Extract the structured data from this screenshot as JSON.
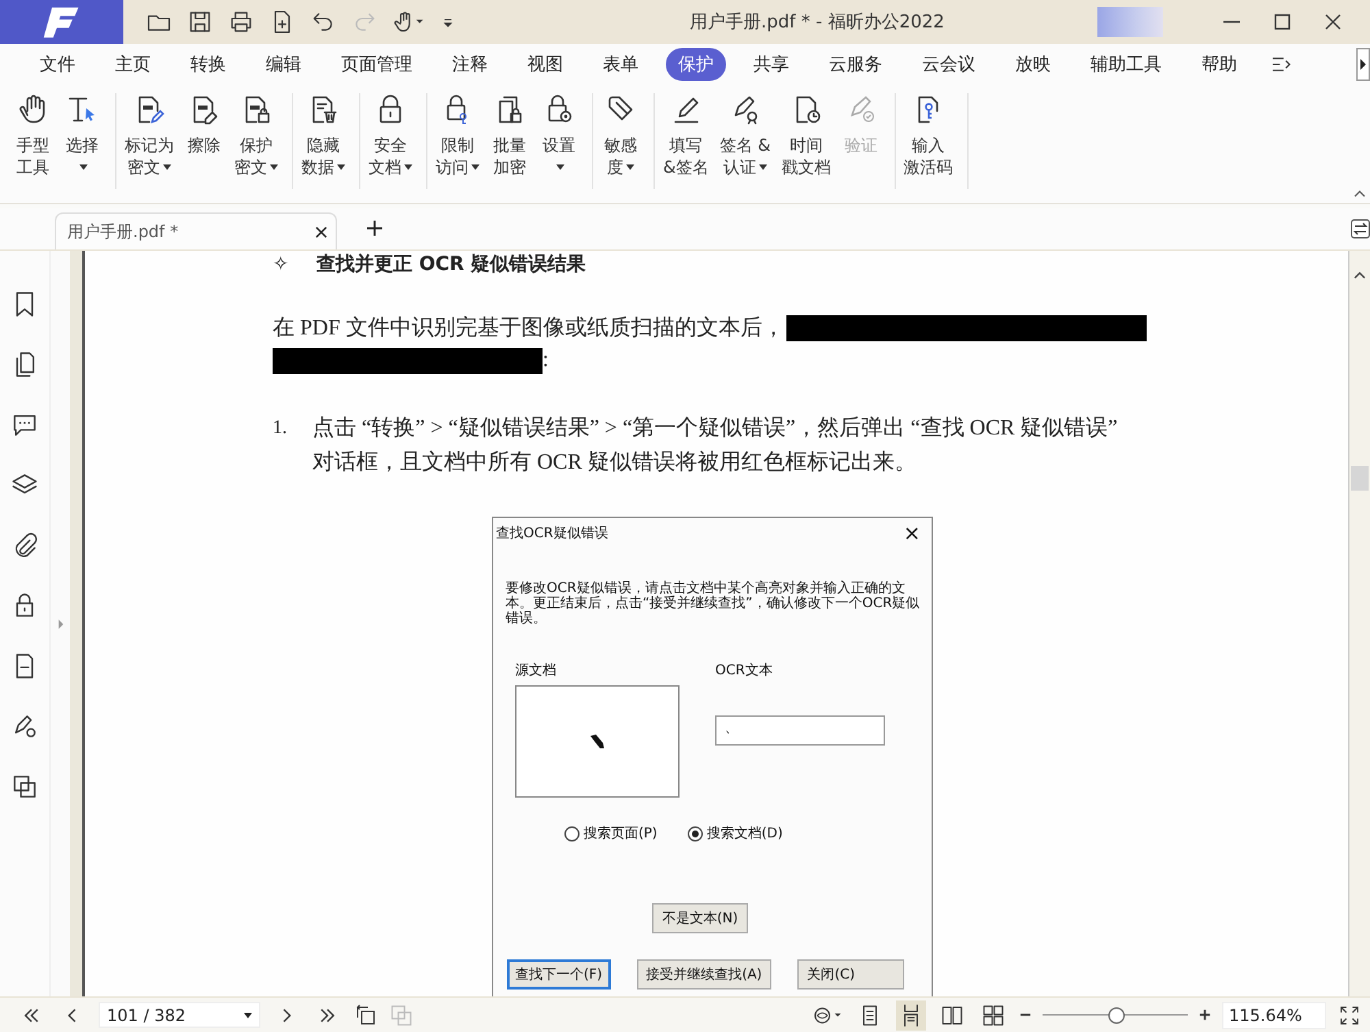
{
  "window": {
    "title": "用户手册.pdf * - 福昕办公2022"
  },
  "menu": [
    {
      "label": "文件",
      "selected": false
    },
    {
      "label": "主页",
      "selected": false
    },
    {
      "label": "转换",
      "selected": false
    },
    {
      "label": "编辑",
      "selected": false
    },
    {
      "label": "页面管理",
      "selected": false
    },
    {
      "label": "注释",
      "selected": false
    },
    {
      "label": "视图",
      "selected": false
    },
    {
      "label": "表单",
      "selected": false
    },
    {
      "label": "保护",
      "selected": true
    },
    {
      "label": "共享",
      "selected": false
    },
    {
      "label": "云服务",
      "selected": false
    },
    {
      "label": "云会议",
      "selected": false
    },
    {
      "label": "放映",
      "selected": false
    },
    {
      "label": "辅助工具",
      "selected": false
    },
    {
      "label": "帮助",
      "selected": false
    }
  ],
  "ribbon": [
    {
      "items": [
        {
          "lines": [
            "手型",
            "工具"
          ],
          "dropdown": false,
          "disabled": false
        },
        {
          "lines": [
            "选择"
          ],
          "dropdown": true,
          "disabled": false
        }
      ]
    },
    {
      "items": [
        {
          "lines": [
            "标记为",
            "密文"
          ],
          "dropdown": true,
          "disabled": false
        },
        {
          "lines": [
            "擦除"
          ],
          "dropdown": false,
          "disabled": false
        },
        {
          "lines": [
            "保护",
            "密文"
          ],
          "dropdown": true,
          "disabled": false
        }
      ]
    },
    {
      "items": [
        {
          "lines": [
            "隐藏",
            "数据"
          ],
          "dropdown": true,
          "disabled": false
        }
      ]
    },
    {
      "items": [
        {
          "lines": [
            "安全",
            "文档"
          ],
          "dropdown": true,
          "disabled": false
        }
      ]
    },
    {
      "items": [
        {
          "lines": [
            "限制",
            "访问"
          ],
          "dropdown": true,
          "disabled": false
        },
        {
          "lines": [
            "批量",
            "加密"
          ],
          "dropdown": false,
          "disabled": false
        },
        {
          "lines": [
            "设置"
          ],
          "dropdown": true,
          "disabled": false
        }
      ]
    },
    {
      "items": [
        {
          "lines": [
            "敏感",
            "度"
          ],
          "dropdown": true,
          "disabled": false
        }
      ]
    },
    {
      "items": [
        {
          "lines": [
            "填写",
            "&签名"
          ],
          "dropdown": false,
          "disabled": false
        },
        {
          "lines": [
            "签名 &",
            "认证"
          ],
          "dropdown": true,
          "disabled": false
        },
        {
          "lines": [
            "时间",
            "戳文档"
          ],
          "dropdown": false,
          "disabled": false
        },
        {
          "lines": [
            "验证"
          ],
          "dropdown": false,
          "disabled": true
        }
      ]
    },
    {
      "items": [
        {
          "lines": [
            "输入",
            "激活码"
          ],
          "dropdown": false,
          "disabled": false
        }
      ]
    }
  ],
  "doc_tabs": [
    {
      "label": "用户手册.pdf *"
    }
  ],
  "document": {
    "heading_mark": "✧",
    "heading": "查找并更正 OCR 疑似错误结果",
    "paragraph": "在 PDF 文件中识别完基于图像或纸质扫描的文本后，",
    "paragraph_end": ":",
    "list": [
      {
        "number": "1.",
        "lines": [
          "点击 “转换” > “疑似错误结果” > “第一个疑似错误”，然后弹出 “查找 OCR 疑似错误”",
          "对话框，且文档中所有 OCR 疑似错误将被用红色框标记出来。"
        ]
      }
    ]
  },
  "dialog": {
    "title": "查找OCR疑似错误",
    "close": "×",
    "description": "要修改OCR疑似错误，请点击文档中某个高亮对象并输入正确的文本。更正结束后，点击“接受并继续查找”，确认修改下一个OCR疑似错误。",
    "source_label": "源文档",
    "ocr_label": "OCR文本",
    "ocr_value": "、",
    "radios": [
      {
        "label": "搜索页面(P)",
        "selected": false
      },
      {
        "label": "搜索文档(D)",
        "selected": true
      }
    ],
    "middle_button": "不是文本(N)",
    "buttons": [
      {
        "label": "查找下一个(F)",
        "focused": true
      },
      {
        "label": "接受并继续查找(A)",
        "focused": false
      },
      {
        "label": "关闭(C)",
        "focused": false
      }
    ]
  },
  "status_bar": {
    "page": "101 / 382",
    "views": [
      {
        "selected": false
      },
      {
        "selected": true
      },
      {
        "selected": false
      },
      {
        "selected": false
      }
    ],
    "zoom": {
      "level": 0.5,
      "reading": "115.64%"
    }
  }
}
